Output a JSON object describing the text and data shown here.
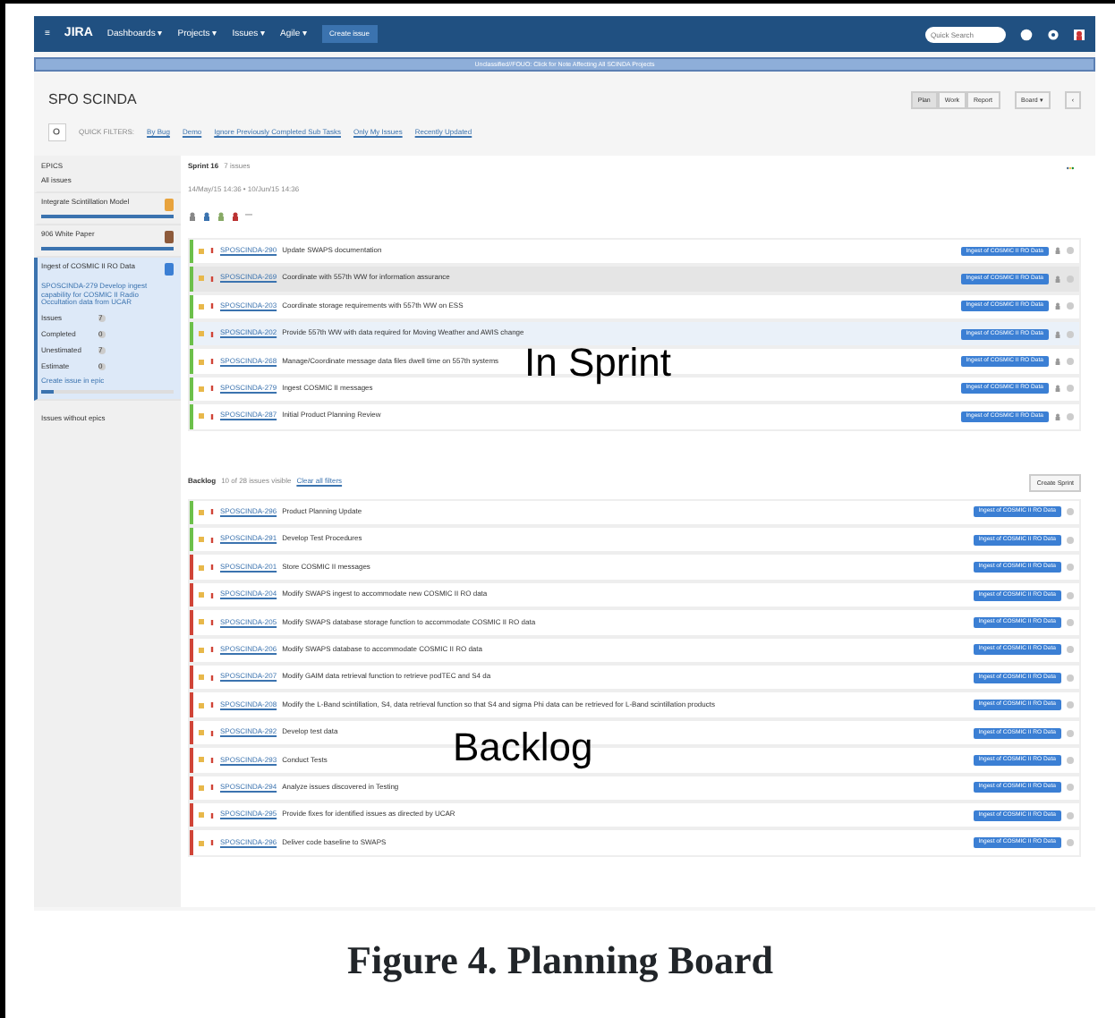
{
  "navbar": {
    "menu_icon": "≡",
    "logo": "JIRA",
    "menus": [
      "Dashboards ▾",
      "Projects ▾",
      "Issues ▾",
      "Agile ▾"
    ],
    "create_button": "Create issue",
    "search": {
      "placeholder": "Quick Search"
    }
  },
  "banner": "Unclassified//FOUO: Click for Note Affecting All SCINDA Projects",
  "project_title": "SPO SCINDA",
  "view_buttons": [
    {
      "label": "Plan",
      "selected": true
    },
    {
      "label": "Work",
      "selected": false
    },
    {
      "label": "Report",
      "selected": false
    }
  ],
  "board_button": "Board ▾",
  "collapse_button": "‹",
  "quick_filters": {
    "label": "QUICK FILTERS:",
    "items": [
      "By Bug",
      "Demo",
      "Ignore Previously Completed Sub Tasks",
      "Only My Issues",
      "Recently Updated"
    ]
  },
  "sidebar": {
    "heading": "EPICS",
    "all_issues": "All issues",
    "epics": [
      {
        "name": "Integrate Scintillation Model",
        "color": "#e8a33d",
        "selected": false,
        "level": 1.0
      },
      {
        "name": "906 White Paper",
        "color": "#8d5a3b",
        "selected": false,
        "level": 1.0
      },
      {
        "name": "Ingest of COSMIC II RO Data",
        "color": "#3b7fd4",
        "selected": true,
        "level": 0.1,
        "description": "SPOSCINDA-279 Develop ingest capability for COSMIC II Radio Occultation data from UCAR",
        "stats": [
          {
            "label": "Issues",
            "value": "7"
          },
          {
            "label": "Completed",
            "value": "0"
          },
          {
            "label": "Unestimated",
            "value": "7"
          },
          {
            "label": "Estimate",
            "value": "0"
          }
        ],
        "create_link": "Create issue in epic"
      }
    ],
    "no_epic": "Issues without epics"
  },
  "sprint": {
    "name": "Sprint 16",
    "count": "7 issues",
    "dates": "14/May/15 14:36 • 10/Jun/15 14:36",
    "more": "—",
    "rows": [
      {
        "key": "SPOSCINDA-290",
        "summary": "Update SWAPS documentation",
        "epic": "Ingest of COSMIC II RO Data",
        "color": "#6cc04a",
        "selected": false,
        "focused": false
      },
      {
        "key": "SPOSCINDA-269",
        "summary": "Coordinate with 557th WW for information assurance",
        "epic": "Ingest of COSMIC II RO Data",
        "color": "#6cc04a",
        "selected": true,
        "focused": false
      },
      {
        "key": "SPOSCINDA-203",
        "summary": "Coordinate storage requirements with 557th WW on ESS",
        "epic": "Ingest of COSMIC II RO Data",
        "color": "#6cc04a",
        "selected": false,
        "focused": false
      },
      {
        "key": "SPOSCINDA-202",
        "summary": "Provide 557th WW with data required for Moving Weather and AWIS change",
        "epic": "Ingest of COSMIC II RO Data",
        "color": "#6cc04a",
        "selected": false,
        "focused": true
      },
      {
        "key": "SPOSCINDA-268",
        "summary": "Manage/Coordinate message data files dwell time on 557th systems",
        "epic": "Ingest of COSMIC II RO Data",
        "color": "#6cc04a",
        "selected": false,
        "focused": false
      },
      {
        "key": "SPOSCINDA-279",
        "summary": "Ingest COSMIC II messages",
        "epic": "Ingest of COSMIC II RO Data",
        "color": "#6cc04a",
        "selected": false,
        "focused": false
      },
      {
        "key": "SPOSCINDA-287",
        "summary": "Initial Product Planning Review",
        "epic": "Ingest of COSMIC II RO Data",
        "color": "#6cc04a",
        "selected": false,
        "focused": false
      }
    ]
  },
  "backlog": {
    "name": "Backlog",
    "count": "10 of 28 issues visible",
    "clear_link": "Clear all filters",
    "create_sprint": "Create Sprint",
    "rows": [
      {
        "key": "SPOSCINDA-296",
        "summary": "Product Planning Update",
        "epic": "Ingest of COSMIC II RO Data",
        "color": "#6cc04a",
        "selected": false,
        "focused": false
      },
      {
        "key": "SPOSCINDA-291",
        "summary": "Develop Test Procedures",
        "epic": "Ingest of COSMIC II RO Data",
        "color": "#6cc04a",
        "selected": false,
        "focused": false
      },
      {
        "key": "SPOSCINDA-201",
        "summary": "Store COSMIC II messages",
        "epic": "Ingest of COSMIC II RO Data",
        "color": "#d04437",
        "selected": false,
        "focused": false
      },
      {
        "key": "SPOSCINDA-204",
        "summary": "Modify SWAPS ingest to accommodate new COSMIC II RO data",
        "epic": "Ingest of COSMIC II RO Data",
        "color": "#d04437",
        "selected": false,
        "focused": false
      },
      {
        "key": "SPOSCINDA-205",
        "summary": "Modify SWAPS database storage function to accommodate COSMIC II RO data",
        "epic": "Ingest of COSMIC II RO Data",
        "color": "#d04437",
        "selected": false,
        "focused": false
      },
      {
        "key": "SPOSCINDA-206",
        "summary": "Modify SWAPS database to accommodate COSMIC II RO data",
        "epic": "Ingest of COSMIC II RO Data",
        "color": "#d04437",
        "selected": false,
        "focused": false
      },
      {
        "key": "SPOSCINDA-207",
        "summary": "Modify GAIM data retrieval function to retrieve podTEC and S4 da",
        "epic": "Ingest of COSMIC II RO Data",
        "color": "#d04437",
        "selected": false,
        "focused": false
      },
      {
        "key": "SPOSCINDA-208",
        "summary": "Modify the L-Band scintillation, S4, data retrieval function so that S4 and sigma Phi data can be retrieved for L-Band scintillation products",
        "epic": "Ingest of COSMIC II RO Data",
        "color": "#d04437",
        "selected": false,
        "focused": false
      },
      {
        "key": "SPOSCINDA-292",
        "summary": "Develop test data",
        "epic": "Ingest of COSMIC II RO Data",
        "color": "#d04437",
        "selected": false,
        "focused": false
      },
      {
        "key": "SPOSCINDA-293",
        "summary": "Conduct Tests",
        "epic": "Ingest of COSMIC II RO Data",
        "color": "#d04437",
        "selected": false,
        "focused": false
      },
      {
        "key": "SPOSCINDA-294",
        "summary": "Analyze issues discovered in Testing",
        "epic": "Ingest of COSMIC II RO Data",
        "color": "#d04437",
        "selected": false,
        "focused": false
      },
      {
        "key": "SPOSCINDA-295",
        "summary": "Provide fixes for identified issues as directed by UCAR",
        "epic": "Ingest of COSMIC II RO Data",
        "color": "#d04437",
        "selected": false,
        "focused": false
      },
      {
        "key": "SPOSCINDA-296",
        "summary": "Deliver code baseline to SWAPS",
        "epic": "Ingest of COSMIC II RO Data",
        "color": "#d04437",
        "selected": false,
        "focused": false
      }
    ]
  },
  "annotations": [
    "In Sprint",
    "Backlog"
  ],
  "caption": "Figure 4. Planning Board"
}
